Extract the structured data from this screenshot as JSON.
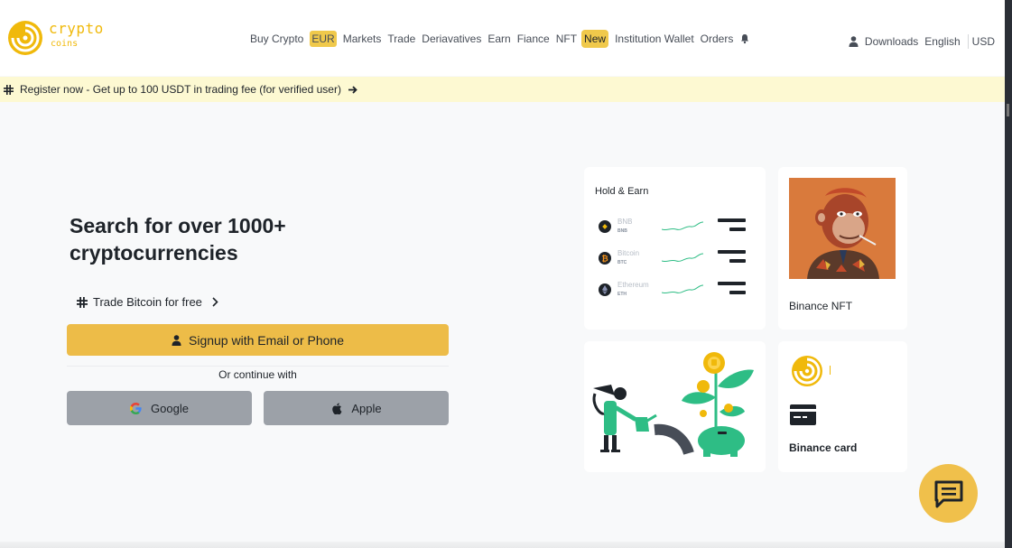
{
  "header": {
    "logo": {
      "line1": "crypto",
      "line2": "coins"
    },
    "nav": [
      {
        "label": "Buy Crypto"
      },
      {
        "label": "EUR",
        "pill": true
      },
      {
        "label": "Markets"
      },
      {
        "label": "Trade"
      },
      {
        "label": "Deriavatives"
      },
      {
        "label": "Earn"
      },
      {
        "label": "Fiance"
      },
      {
        "label": "NFT"
      },
      {
        "label": "New",
        "pill": true
      },
      {
        "label": "Institution Wallet"
      },
      {
        "label": "Orders"
      }
    ],
    "right": {
      "downloads": "Downloads",
      "language": "English",
      "currency": "USD"
    }
  },
  "banner": {
    "text": "Register now - Get up to 100 USDT in trading fee (for verified user)"
  },
  "hero": {
    "title": "Search for over 1000+ cryptocurrencies",
    "trade_link": "Trade Bitcoin for free",
    "signup_label": "Signup with Email or Phone",
    "continue_text": "Or continue with",
    "google_label": "Google",
    "apple_label": "Apple"
  },
  "hold_earn": {
    "title": "Hold & Earn",
    "coins": [
      {
        "name": "BNB",
        "symbol": "BNB",
        "color": "#f0b90b"
      },
      {
        "name": "Bitcoin",
        "symbol": "BTC",
        "color": "#f7931a"
      },
      {
        "name": "Ethereum",
        "symbol": "ETH",
        "color": "#627eea"
      }
    ]
  },
  "nft_card": {
    "label": "Binance NFT"
  },
  "binance_card": {
    "label": "Binance card"
  },
  "colors": {
    "accent": "#f0b90b",
    "button": "#edbc48",
    "banner": "#fdf9d2",
    "social_button": "#9ca1a8",
    "spark": "#2ebd85"
  },
  "icons": [
    "bell-icon",
    "user-icon",
    "chevron-right-icon",
    "google-icon",
    "apple-icon",
    "chat-icon",
    "card-icon"
  ]
}
